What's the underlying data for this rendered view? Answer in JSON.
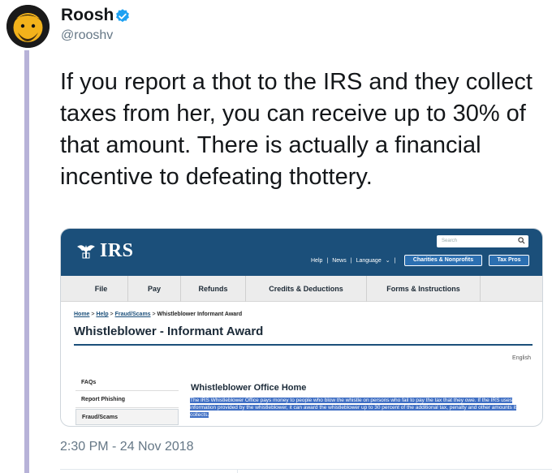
{
  "tweet": {
    "author": {
      "name": "Roosh",
      "handle": "@rooshv",
      "verified": true
    },
    "text": "If you report a thot to the IRS and they collect taxes from her, you can receive up to 30% of that amount. There is actually a financial incentive to defeating thottery.",
    "timestamp": "2:30 PM - 24 Nov 2018"
  },
  "embed": {
    "logo_text": "IRS",
    "search_placeholder": "Search",
    "util_links": [
      "Help",
      "News",
      "Language"
    ],
    "buttons": {
      "charities": "Charities & Nonprofits",
      "tax_pros": "Tax Pros"
    },
    "nav": [
      "File",
      "Pay",
      "Refunds",
      "Credits & Deductions",
      "Forms & Instructions"
    ],
    "breadcrumb": {
      "home": "Home",
      "help": "Help",
      "fraud": "Fraud/Scams",
      "current": "Whistleblower Informant Award"
    },
    "page_title": "Whistleblower - Informant Award",
    "language": "English",
    "sidebar": [
      "FAQs",
      "Report Phishing",
      "Fraud/Scams"
    ],
    "section_title": "Whistleblower Office Home",
    "highlight_text": "The IRS Whistleblower Office pays money to people who blow the whistle on persons who fail to pay the tax that they owe. If the IRS uses information provided by the whistleblower, it can award the whistleblower up to 30 percent of the additional tax, penalty and other amounts it collects."
  },
  "colors": {
    "irs_blue": "#1b4f7a",
    "highlight": "#3f6fc4",
    "thread_line": "#b7b2d8",
    "verified_blue": "#1da1f2",
    "muted_text": "#657786"
  }
}
